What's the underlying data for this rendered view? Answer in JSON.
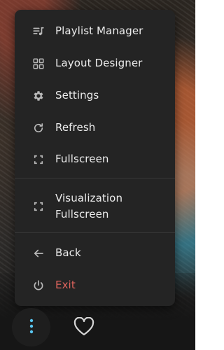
{
  "menu": {
    "items": [
      {
        "label": "Playlist Manager",
        "icon": "playlist-icon"
      },
      {
        "label": "Layout Designer",
        "icon": "grid-icon"
      },
      {
        "label": "Settings",
        "icon": "gear-icon"
      },
      {
        "label": "Refresh",
        "icon": "refresh-icon"
      },
      {
        "label": "Fullscreen",
        "icon": "fullscreen-icon"
      },
      {
        "label": "Visualization Fullscreen",
        "label_line1": "Visualization",
        "label_line2": "Fullscreen",
        "icon": "fullscreen-icon"
      },
      {
        "label": "Back",
        "icon": "back-arrow-icon"
      },
      {
        "label": "Exit",
        "icon": "power-icon"
      }
    ]
  },
  "dock": {
    "menu_button_icon": "kebab-menu-icon",
    "favorite_icon": "heart-icon"
  },
  "colors": {
    "menu_bg": "#242424",
    "text": "#ececec",
    "icon": "#b9b9b9",
    "exit": "#e1655e",
    "accent_dots": "#59c6f2"
  }
}
